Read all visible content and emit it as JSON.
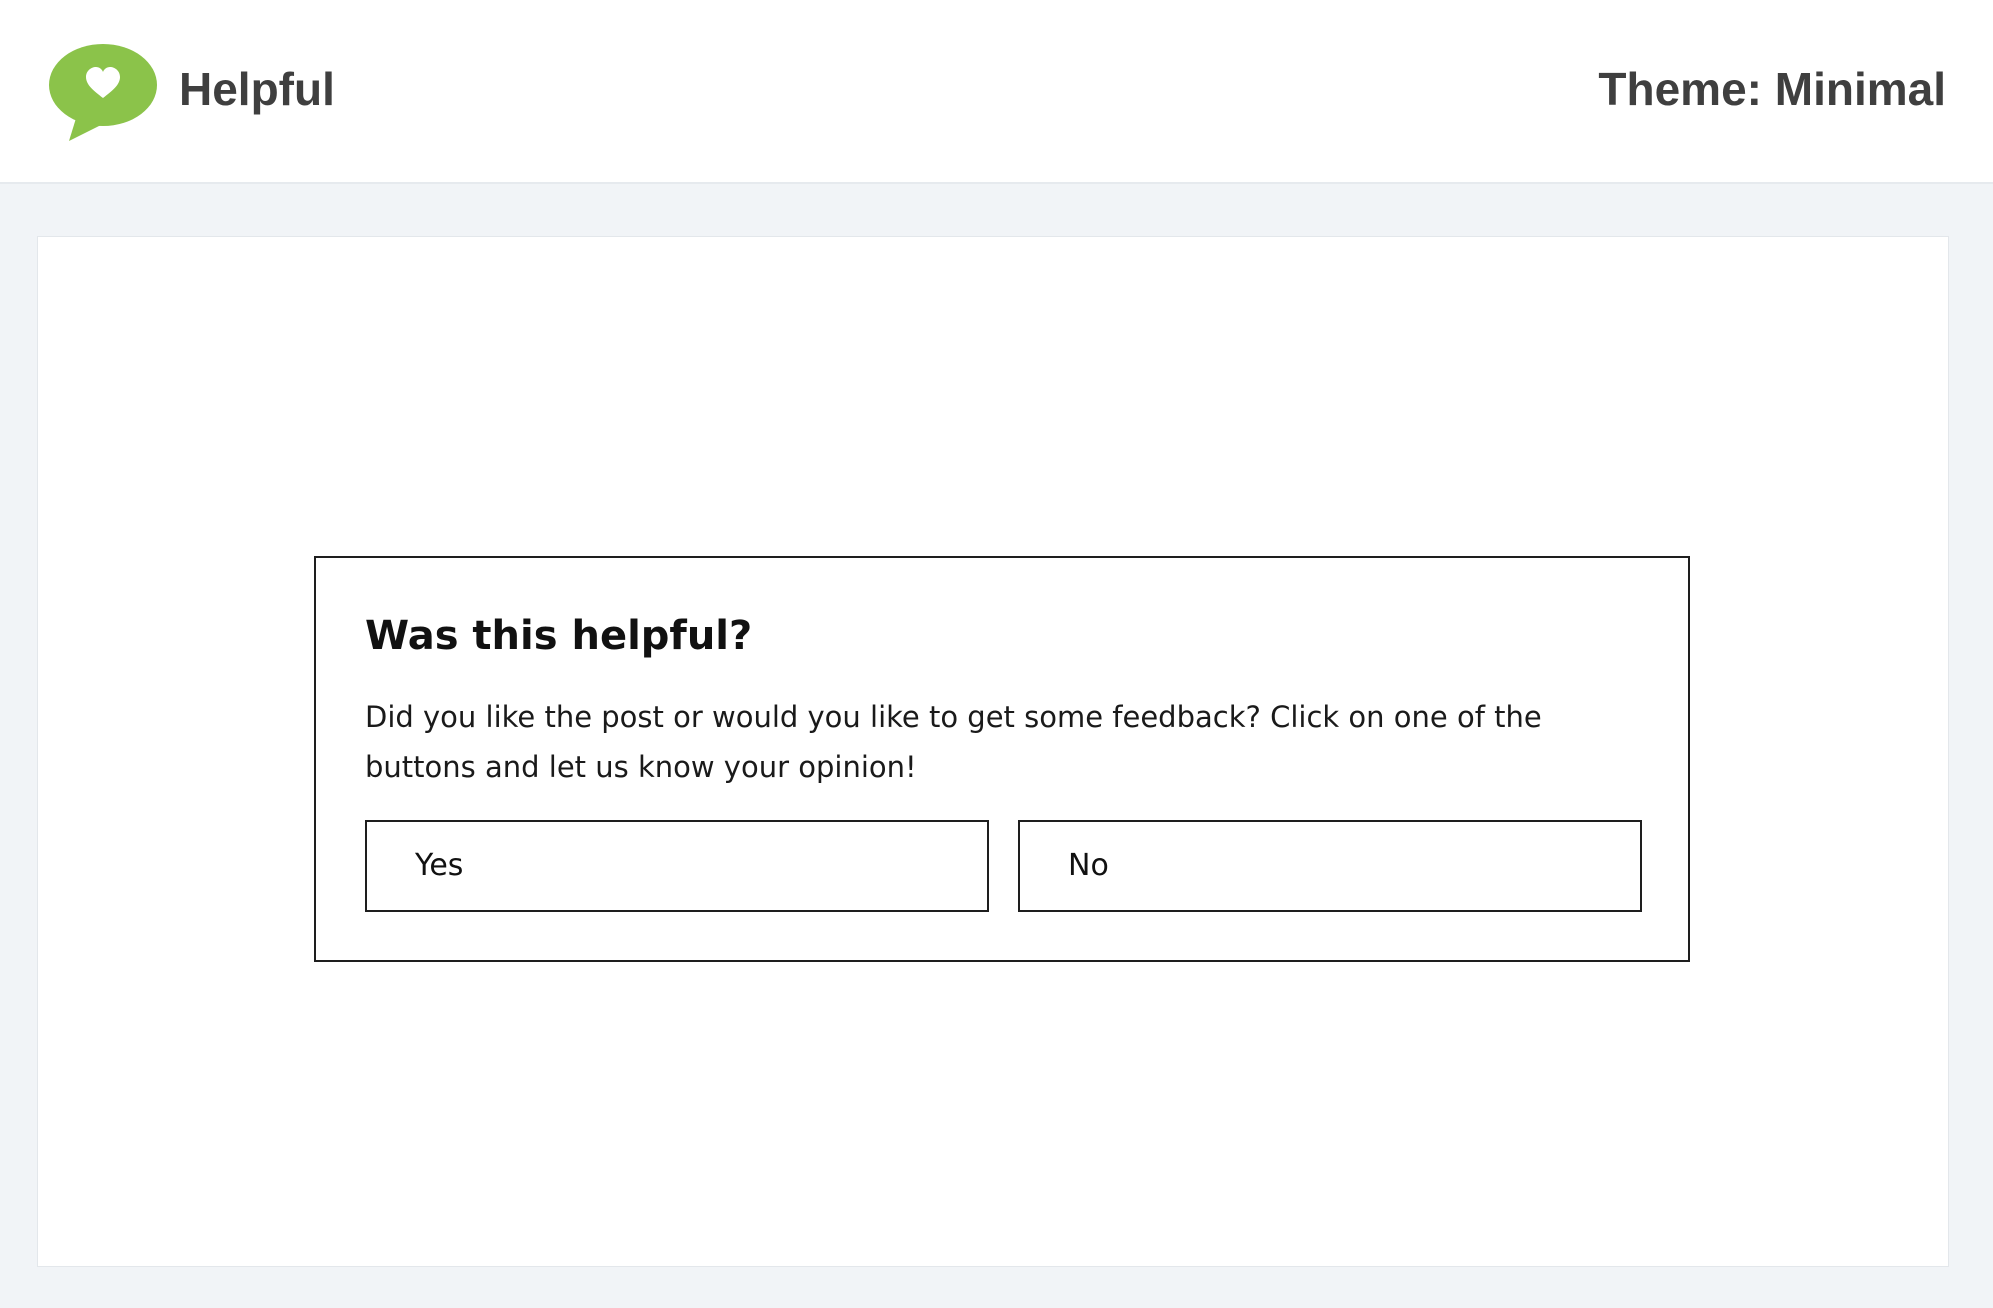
{
  "header": {
    "brand_name": "Helpful",
    "theme_label": "Theme: Minimal",
    "logo_icon": "heart-speech-bubble-icon",
    "logo_color": "#8bc34a"
  },
  "widget": {
    "title": "Was this helpful?",
    "description": "Did you like the post or would you like to get some feedback? Click on one of the buttons and let us know your opinion!",
    "yes_label": "Yes",
    "no_label": "No"
  },
  "colors": {
    "page_background": "#f1f4f7",
    "header_background": "#ffffff",
    "widget_border": "#1e1e1e",
    "text": "#3f3f3f"
  }
}
